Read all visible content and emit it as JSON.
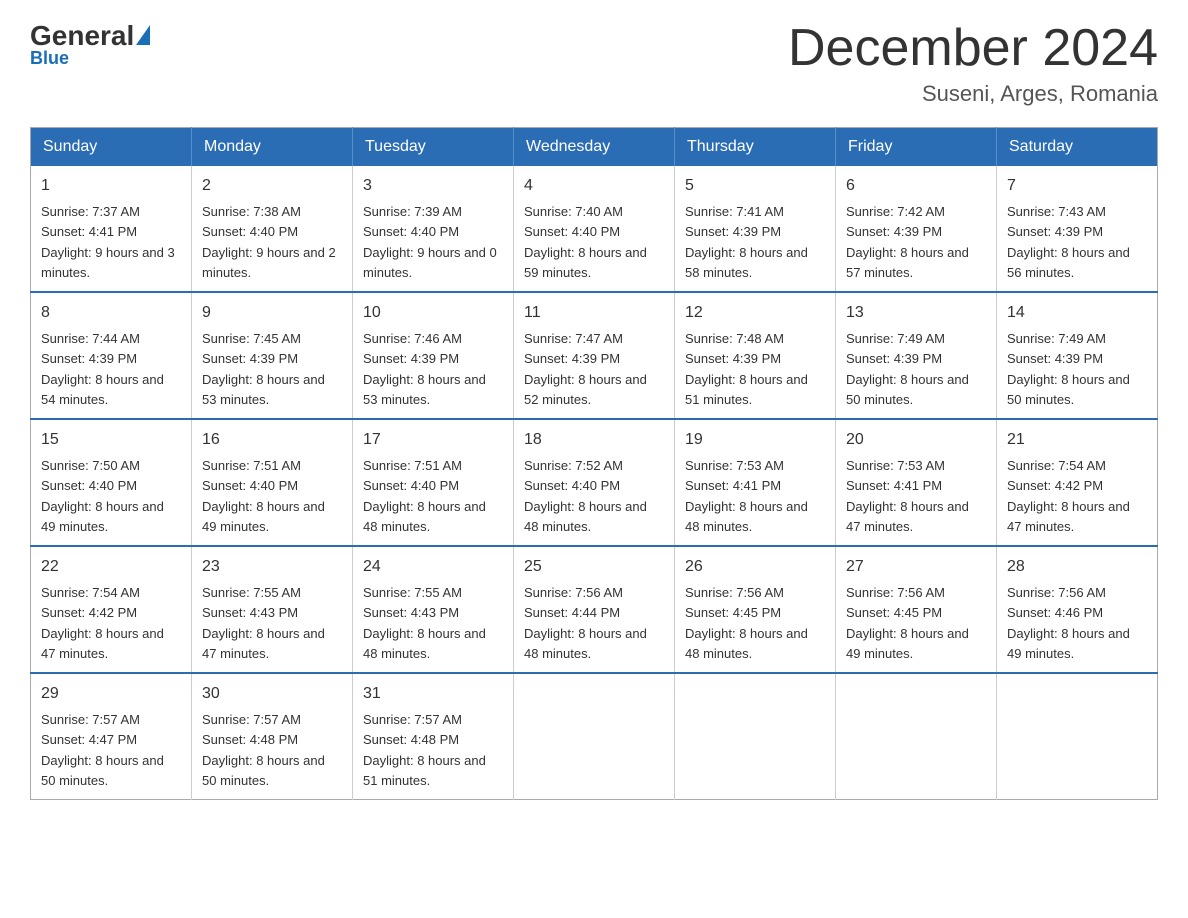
{
  "header": {
    "logo": {
      "general": "General",
      "blue": "Blue"
    },
    "title": "December 2024",
    "location": "Suseni, Arges, Romania"
  },
  "weekdays": [
    "Sunday",
    "Monday",
    "Tuesday",
    "Wednesday",
    "Thursday",
    "Friday",
    "Saturday"
  ],
  "weeks": [
    [
      {
        "day": "1",
        "sunrise": "7:37 AM",
        "sunset": "4:41 PM",
        "daylight": "9 hours and 3 minutes."
      },
      {
        "day": "2",
        "sunrise": "7:38 AM",
        "sunset": "4:40 PM",
        "daylight": "9 hours and 2 minutes."
      },
      {
        "day": "3",
        "sunrise": "7:39 AM",
        "sunset": "4:40 PM",
        "daylight": "9 hours and 0 minutes."
      },
      {
        "day": "4",
        "sunrise": "7:40 AM",
        "sunset": "4:40 PM",
        "daylight": "8 hours and 59 minutes."
      },
      {
        "day": "5",
        "sunrise": "7:41 AM",
        "sunset": "4:39 PM",
        "daylight": "8 hours and 58 minutes."
      },
      {
        "day": "6",
        "sunrise": "7:42 AM",
        "sunset": "4:39 PM",
        "daylight": "8 hours and 57 minutes."
      },
      {
        "day": "7",
        "sunrise": "7:43 AM",
        "sunset": "4:39 PM",
        "daylight": "8 hours and 56 minutes."
      }
    ],
    [
      {
        "day": "8",
        "sunrise": "7:44 AM",
        "sunset": "4:39 PM",
        "daylight": "8 hours and 54 minutes."
      },
      {
        "day": "9",
        "sunrise": "7:45 AM",
        "sunset": "4:39 PM",
        "daylight": "8 hours and 53 minutes."
      },
      {
        "day": "10",
        "sunrise": "7:46 AM",
        "sunset": "4:39 PM",
        "daylight": "8 hours and 53 minutes."
      },
      {
        "day": "11",
        "sunrise": "7:47 AM",
        "sunset": "4:39 PM",
        "daylight": "8 hours and 52 minutes."
      },
      {
        "day": "12",
        "sunrise": "7:48 AM",
        "sunset": "4:39 PM",
        "daylight": "8 hours and 51 minutes."
      },
      {
        "day": "13",
        "sunrise": "7:49 AM",
        "sunset": "4:39 PM",
        "daylight": "8 hours and 50 minutes."
      },
      {
        "day": "14",
        "sunrise": "7:49 AM",
        "sunset": "4:39 PM",
        "daylight": "8 hours and 50 minutes."
      }
    ],
    [
      {
        "day": "15",
        "sunrise": "7:50 AM",
        "sunset": "4:40 PM",
        "daylight": "8 hours and 49 minutes."
      },
      {
        "day": "16",
        "sunrise": "7:51 AM",
        "sunset": "4:40 PM",
        "daylight": "8 hours and 49 minutes."
      },
      {
        "day": "17",
        "sunrise": "7:51 AM",
        "sunset": "4:40 PM",
        "daylight": "8 hours and 48 minutes."
      },
      {
        "day": "18",
        "sunrise": "7:52 AM",
        "sunset": "4:40 PM",
        "daylight": "8 hours and 48 minutes."
      },
      {
        "day": "19",
        "sunrise": "7:53 AM",
        "sunset": "4:41 PM",
        "daylight": "8 hours and 48 minutes."
      },
      {
        "day": "20",
        "sunrise": "7:53 AM",
        "sunset": "4:41 PM",
        "daylight": "8 hours and 47 minutes."
      },
      {
        "day": "21",
        "sunrise": "7:54 AM",
        "sunset": "4:42 PM",
        "daylight": "8 hours and 47 minutes."
      }
    ],
    [
      {
        "day": "22",
        "sunrise": "7:54 AM",
        "sunset": "4:42 PM",
        "daylight": "8 hours and 47 minutes."
      },
      {
        "day": "23",
        "sunrise": "7:55 AM",
        "sunset": "4:43 PM",
        "daylight": "8 hours and 47 minutes."
      },
      {
        "day": "24",
        "sunrise": "7:55 AM",
        "sunset": "4:43 PM",
        "daylight": "8 hours and 48 minutes."
      },
      {
        "day": "25",
        "sunrise": "7:56 AM",
        "sunset": "4:44 PM",
        "daylight": "8 hours and 48 minutes."
      },
      {
        "day": "26",
        "sunrise": "7:56 AM",
        "sunset": "4:45 PM",
        "daylight": "8 hours and 48 minutes."
      },
      {
        "day": "27",
        "sunrise": "7:56 AM",
        "sunset": "4:45 PM",
        "daylight": "8 hours and 49 minutes."
      },
      {
        "day": "28",
        "sunrise": "7:56 AM",
        "sunset": "4:46 PM",
        "daylight": "8 hours and 49 minutes."
      }
    ],
    [
      {
        "day": "29",
        "sunrise": "7:57 AM",
        "sunset": "4:47 PM",
        "daylight": "8 hours and 50 minutes."
      },
      {
        "day": "30",
        "sunrise": "7:57 AM",
        "sunset": "4:48 PM",
        "daylight": "8 hours and 50 minutes."
      },
      {
        "day": "31",
        "sunrise": "7:57 AM",
        "sunset": "4:48 PM",
        "daylight": "8 hours and 51 minutes."
      },
      null,
      null,
      null,
      null
    ]
  ]
}
